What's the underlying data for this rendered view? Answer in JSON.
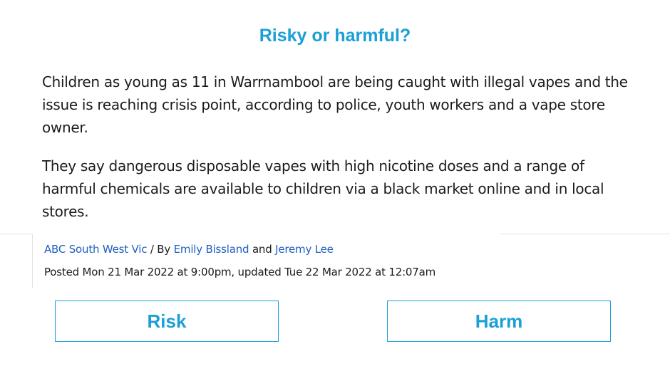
{
  "heading": "Risky or harmful?",
  "paragraphs": [
    "Children as young as 11 in Warrnambool are being caught with illegal vapes and the issue is reaching crisis point, according to police, youth workers and a vape store owner.",
    "They say dangerous disposable vapes with high nicotine doses and a range of harmful chemicals are available to children via a black market online and in local stores."
  ],
  "byline": {
    "source": "ABC South West Vic",
    "separator": " / By ",
    "author_1": "Emily Bissland",
    "conjunction": " and ",
    "author_2": "Jeremy Lee"
  },
  "posted": "Posted Mon 21 Mar 2022 at 9:00pm, updated Tue 22 Mar 2022 at 12:07am",
  "choices": {
    "risk_label": "Risk",
    "harm_label": "Harm"
  },
  "colors": {
    "accent": "#1b9fd6",
    "link": "#1f5fbf",
    "text": "#1b1b1b",
    "divider": "#e3e3e3"
  }
}
